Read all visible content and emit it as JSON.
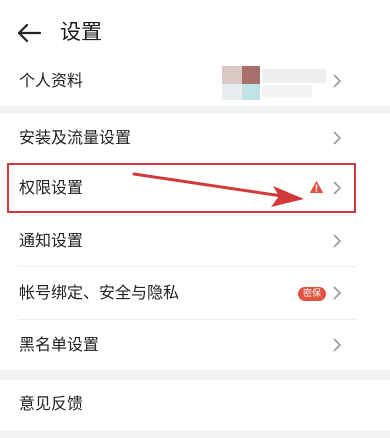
{
  "header": {
    "title": "设置",
    "back_icon": "arrow-left-icon"
  },
  "rows": [
    {
      "label": "个人资料"
    },
    {
      "label": "安装及流量设置"
    },
    {
      "label": "权限设置"
    },
    {
      "label": "通知设置"
    },
    {
      "label": "帐号绑定、安全与隐私",
      "badge": "密保"
    },
    {
      "label": "黑名单设置"
    },
    {
      "label": "意见反馈"
    }
  ],
  "icons": {
    "chevron": "chevron-right-icon",
    "warning": "warning-triangle-icon"
  },
  "colors": {
    "highlight": "#d23a3a",
    "warning": "#e0533f",
    "badge": "#e0533f",
    "chevron": "#9a9a9a",
    "divider": "#ececec",
    "group_gap": "#f3f3f3"
  }
}
